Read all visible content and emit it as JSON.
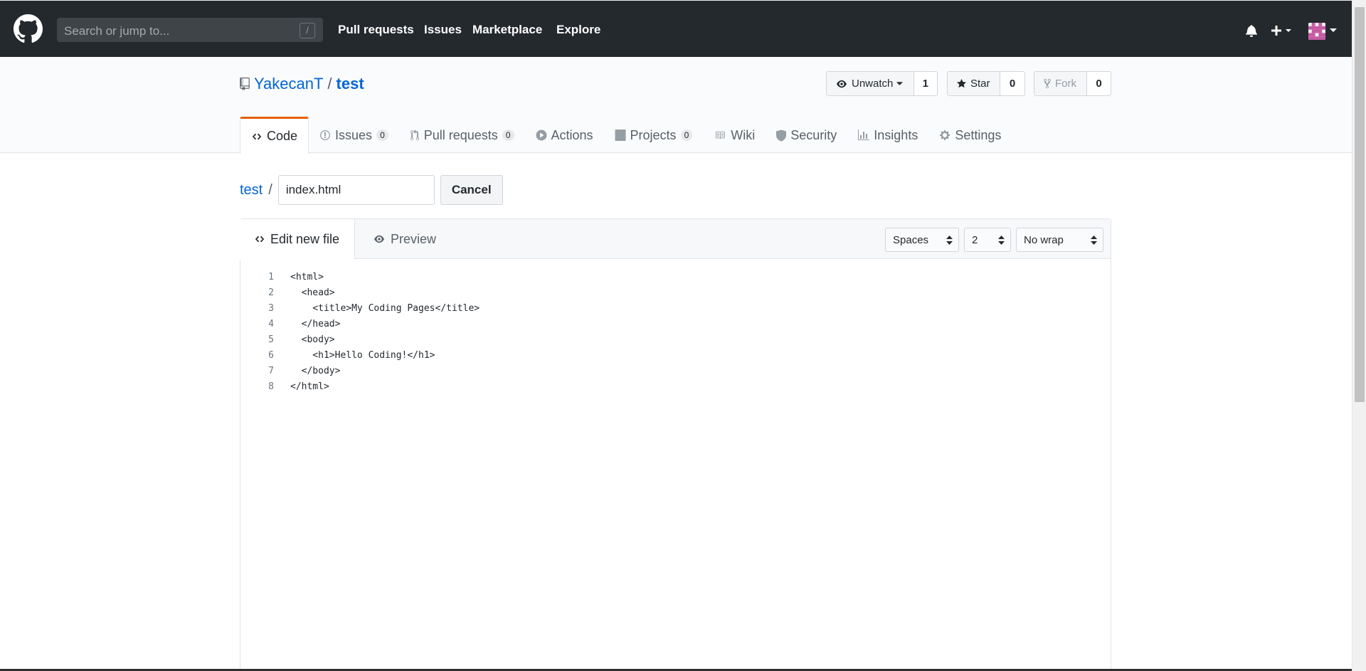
{
  "header": {
    "search_placeholder": "Search or jump to...",
    "search_shortcut": "/",
    "nav": [
      "Pull requests",
      "Issues",
      "Marketplace",
      "Explore"
    ],
    "icons": [
      "github-logo",
      "bell-icon",
      "plus-icon",
      "avatar"
    ]
  },
  "repo": {
    "owner": "YakecanT",
    "separator": "/",
    "name": "test",
    "watch": {
      "label": "Unwatch",
      "count": "1"
    },
    "star": {
      "label": "Star",
      "count": "0"
    },
    "fork": {
      "label": "Fork",
      "count": "0"
    }
  },
  "tabs": [
    {
      "label": "Code",
      "icon": "code-icon",
      "counter": ""
    },
    {
      "label": "Issues",
      "icon": "issue-icon",
      "counter": "0"
    },
    {
      "label": "Pull requests",
      "icon": "pull-request-icon",
      "counter": "0"
    },
    {
      "label": "Actions",
      "icon": "play-icon",
      "counter": ""
    },
    {
      "label": "Projects",
      "icon": "project-icon",
      "counter": "0"
    },
    {
      "label": "Wiki",
      "icon": "book-icon",
      "counter": ""
    },
    {
      "label": "Security",
      "icon": "shield-icon",
      "counter": ""
    },
    {
      "label": "Insights",
      "icon": "graph-icon",
      "counter": ""
    },
    {
      "label": "Settings",
      "icon": "gear-icon",
      "counter": ""
    }
  ],
  "breadcrumb": {
    "repo_link": "test",
    "separator": "/",
    "filename": "index.html",
    "cancel": "Cancel"
  },
  "editor": {
    "tab_edit": "Edit new file",
    "tab_preview": "Preview",
    "indent_mode": "Spaces",
    "indent_size": "2",
    "wrap_mode": "No wrap",
    "lines": [
      {
        "n": "1",
        "text": "<html>"
      },
      {
        "n": "2",
        "text": "  <head>"
      },
      {
        "n": "3",
        "text": "    <title>My Coding Pages</title>"
      },
      {
        "n": "4",
        "text": "  </head>"
      },
      {
        "n": "5",
        "text": "  <body>"
      },
      {
        "n": "6",
        "text": "    <h1>Hello Coding!</h1>"
      },
      {
        "n": "7",
        "text": "  </body>"
      },
      {
        "n": "8",
        "text": "</html>"
      }
    ]
  },
  "colors": {
    "header_bg": "#24292e",
    "link": "#0366d6",
    "tab_accent": "#e36209"
  }
}
